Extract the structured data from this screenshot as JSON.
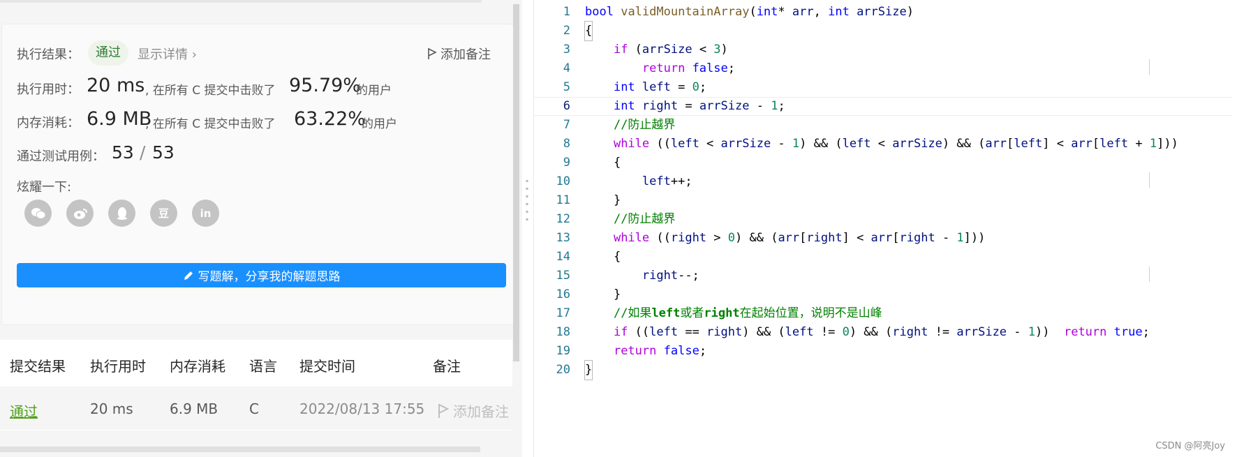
{
  "result": {
    "status_label": "执行结果：",
    "status": "通过",
    "show_details": "显示详情",
    "add_note": "添加备注",
    "runtime_label": "执行用时：",
    "runtime": "20 ms",
    "runtime_suffix": ", 在所有 C 提交中击败了",
    "runtime_pct": "95.79%",
    "users": "的用户",
    "memory_label": "内存消耗：",
    "memory": "6.9 MB",
    "memory_suffix": ", 在所有 C 提交中击败了",
    "memory_pct": "63.22%",
    "tests_label": "通过测试用例：",
    "tests_passed": "53",
    "tests_sep": "/",
    "tests_total": "53",
    "share_label": "炫耀一下:",
    "share_icons": [
      "wechat-icon",
      "weibo-icon",
      "qq-icon",
      "douban-icon",
      "linkedin-icon"
    ],
    "write_solution": "写题解，分享我的解题思路"
  },
  "submissions": {
    "headers": [
      "提交结果",
      "执行用时",
      "内存消耗",
      "语言",
      "提交时间",
      "备注"
    ],
    "row": {
      "result": "通过",
      "runtime": "20 ms",
      "memory": "6.9 MB",
      "language": "C",
      "time": "2022/08/13 17:55",
      "note": "添加备注"
    }
  },
  "code": {
    "line_numbers": [
      "1",
      "2",
      "3",
      "4",
      "5",
      "6",
      "7",
      "8",
      "9",
      "10",
      "11",
      "12",
      "13",
      "14",
      "15",
      "16",
      "17",
      "18",
      "19",
      "20"
    ]
  },
  "watermark": "CSDN @阿亮Joy",
  "colors": {
    "accent": "#1a90ff",
    "pass": "#2e7d32",
    "keyword": "#0000ff",
    "control": "#af00db",
    "number": "#098658",
    "comment": "#008000"
  }
}
